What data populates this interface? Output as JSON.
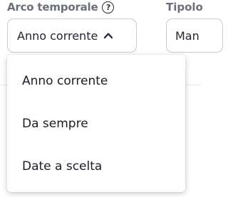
{
  "filters": {
    "time_range": {
      "label": "Arco temporale",
      "help_icon": "?",
      "selected": "Anno corrente",
      "options": [
        "Anno corrente",
        "Da sempre",
        "Date a scelta"
      ]
    },
    "type": {
      "label": "Tipolo",
      "selected": "Man"
    }
  },
  "icons": {
    "help": "help-circle-icon",
    "chevron": "chevron-up-icon"
  }
}
